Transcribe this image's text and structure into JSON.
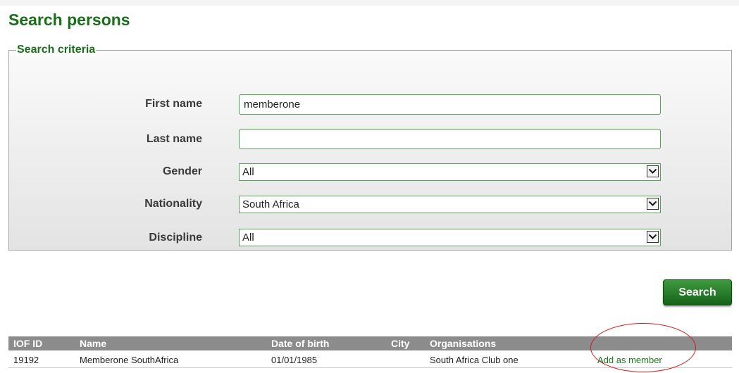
{
  "page": {
    "title": "Search persons"
  },
  "criteria": {
    "legend": "Search criteria",
    "first_name": {
      "label": "First name",
      "value": "memberone"
    },
    "last_name": {
      "label": "Last name",
      "value": ""
    },
    "gender": {
      "label": "Gender",
      "selected": "All"
    },
    "nationality": {
      "label": "Nationality",
      "selected": "South Africa"
    },
    "discipline": {
      "label": "Discipline",
      "selected": "All"
    }
  },
  "search_button": {
    "label": "Search"
  },
  "results": {
    "columns": [
      "IOF ID",
      "Name",
      "Date of birth",
      "City",
      "Organisations"
    ],
    "rows": [
      {
        "iof_id": "19192",
        "name": "Memberone SouthAfrica",
        "date_of_birth": "01/01/1985",
        "city": "",
        "organisations": "South Africa Club one",
        "action": "Add as member"
      }
    ]
  },
  "colors": {
    "title_green": "#1a6e1a",
    "button_green": "#16631a",
    "link_green": "#1a7a1a",
    "header_gray": "#8c8c8c",
    "highlight_red": "#d11c1c"
  },
  "icons": {
    "select_arrow": "chevron-down-icon"
  }
}
